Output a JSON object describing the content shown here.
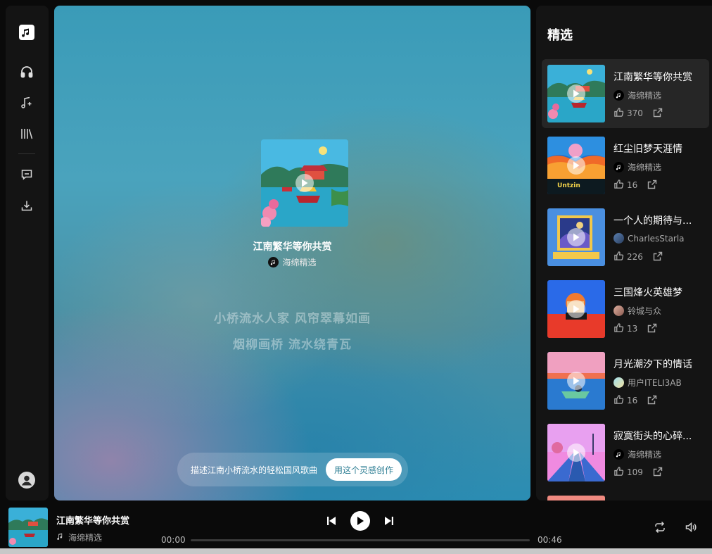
{
  "sidebar": {
    "logo": "music-note-icon",
    "items": [
      {
        "icon": "headphones-icon",
        "name": "listen"
      },
      {
        "icon": "music-plus-icon",
        "name": "create"
      },
      {
        "icon": "library-icon",
        "name": "library"
      },
      {
        "icon": "message-icon",
        "name": "feedback"
      },
      {
        "icon": "download-icon",
        "name": "download"
      }
    ],
    "user_icon": "user-avatar-icon"
  },
  "stage": {
    "song_title": "江南繁华等你共赏",
    "artist": "海绵精选",
    "lyrics": [
      "小桥流水人家 风帘翠幕如画",
      "烟柳画桥 流水绕青瓦"
    ],
    "prompt_text": "描述江南小桥流水的轻松国风歌曲",
    "prompt_button": "用这个灵感创作"
  },
  "featured": {
    "title": "精选",
    "songs": [
      {
        "title": "江南繁华等你共赏",
        "artist": "海绵精选",
        "likes": "370",
        "active": true
      },
      {
        "title": "红尘旧梦天涯情",
        "artist": "海绵精选",
        "likes": "16",
        "active": false
      },
      {
        "title": "一个人的期待与...",
        "artist": "CharlesStarla",
        "likes": "226",
        "active": false
      },
      {
        "title": "三国烽火英雄梦",
        "artist": "铃城与众",
        "likes": "13",
        "active": false
      },
      {
        "title": "月光潮汐下的情话",
        "artist": "用户ITELI3AB",
        "likes": "16",
        "active": false
      },
      {
        "title": "寂寞街头的心碎...",
        "artist": "海绵精选",
        "likes": "109",
        "active": false
      }
    ]
  },
  "player": {
    "title": "江南繁华等你共赏",
    "artist": "海绵精选",
    "current_time": "00:00",
    "duration": "00:46",
    "progress": 0
  },
  "colors": {
    "accent_button_text": "#2f7f95",
    "panel": "#141414",
    "background": "#0a0a0a"
  }
}
